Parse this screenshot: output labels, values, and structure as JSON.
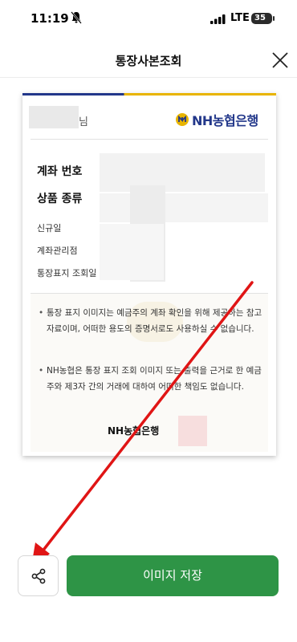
{
  "status_bar": {
    "time": "11:19",
    "network": "LTE",
    "battery": "35",
    "icons": [
      "bell-slash-icon",
      "signal-icon",
      "battery-icon"
    ]
  },
  "header": {
    "title": "통장사본조회",
    "close_icon": "close-icon"
  },
  "card": {
    "holder_suffix": "님",
    "bank_name": "NH농협은행",
    "fields": {
      "account_number": "계좌 번호",
      "product_type": "상품 종류",
      "opened": "신규일",
      "branch": "계좌관리점",
      "viewed": "통장표지 조회일"
    },
    "notes": [
      "통장 표지 이미지는 예금주의 계좌 확인을 위해 제공하는 참고 자료이며, 어떠한 용도의 증명서로도 사용하실 수 없습니다.",
      "NH농협은 통장 표지 조회 이미지 또는 출력을 근거로 한 예금주와 제3자 간의 거래에 대하여 어떠한 책임도 없습니다."
    ],
    "footer_bank": "NH농협은행"
  },
  "actions": {
    "share_icon": "share-icon",
    "save_label": "이미지 저장"
  },
  "colors": {
    "accent_green": "#2e9446",
    "nh_blue": "#22378a",
    "arrow_red": "#e01515"
  }
}
